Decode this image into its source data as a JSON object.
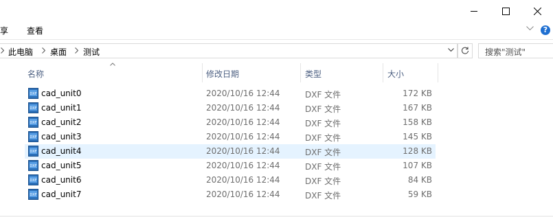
{
  "ribbon": {
    "tabs": [
      "享",
      "查看"
    ]
  },
  "address": {
    "path": [
      "此电脑",
      "桌面",
      "测试"
    ]
  },
  "search": {
    "placeholder": "搜索\"测试\""
  },
  "columns": {
    "name": "名称",
    "date": "修改日期",
    "type": "类型",
    "size": "大小"
  },
  "files": [
    {
      "name": "cad_unit0",
      "date": "2020/10/16 12:44",
      "type": "DXF 文件",
      "size": "172 KB"
    },
    {
      "name": "cad_unit1",
      "date": "2020/10/16 12:44",
      "type": "DXF 文件",
      "size": "167 KB"
    },
    {
      "name": "cad_unit2",
      "date": "2020/10/16 12:44",
      "type": "DXF 文件",
      "size": "158 KB"
    },
    {
      "name": "cad_unit3",
      "date": "2020/10/16 12:44",
      "type": "DXF 文件",
      "size": "145 KB"
    },
    {
      "name": "cad_unit4",
      "date": "2020/10/16 12:44",
      "type": "DXF 文件",
      "size": "128 KB"
    },
    {
      "name": "cad_unit5",
      "date": "2020/10/16 12:44",
      "type": "DXF 文件",
      "size": "107 KB"
    },
    {
      "name": "cad_unit6",
      "date": "2020/10/16 12:44",
      "type": "DXF 文件",
      "size": "84 KB"
    },
    {
      "name": "cad_unit7",
      "date": "2020/10/16 12:44",
      "type": "DXF 文件",
      "size": "59 KB"
    }
  ],
  "selected_index": 4,
  "icons": {
    "minimize": "minimize-icon",
    "maximize": "maximize-icon",
    "close": "close-icon",
    "help": "?",
    "file": "dxf-file-icon",
    "refresh": "refresh-icon"
  },
  "colors": {
    "selection": "#e5f3ff",
    "header_text": "#4d6082",
    "accent": "#1f6fd1"
  }
}
